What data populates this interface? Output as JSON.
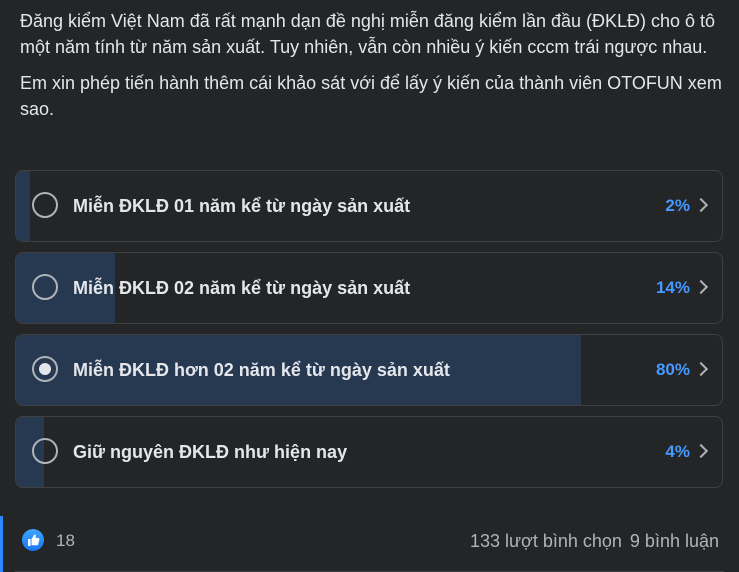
{
  "post": {
    "paragraphs": [
      "Đăng kiểm Việt Nam đã rất mạnh dạn đề nghị miễn đăng kiểm lần đầu (ĐKLĐ) cho ô tô một năm tính từ năm sản xuất. Tuy nhiên, vẫn còn nhiều ý kiến cccm trái ngược nhau.",
      "Em xin phép tiến hành thêm cái khảo sát với để lấy ý kiến của thành viên OTOFUN xem sao."
    ]
  },
  "poll": {
    "options": [
      {
        "label": "Miễn ĐKLĐ 01 năm kể từ ngày sản xuất",
        "percent_text": "2%",
        "percent": 2,
        "selected": false
      },
      {
        "label": "Miễn ĐKLĐ 02 năm kể từ ngày sản xuất",
        "percent_text": "14%",
        "percent": 14,
        "selected": false
      },
      {
        "label": "Miễn ĐKLĐ hơn 02 năm kể từ ngày sản xuất",
        "percent_text": "80%",
        "percent": 80,
        "selected": true
      },
      {
        "label": "Giữ nguyên ĐKLĐ như hiện nay",
        "percent_text": "4%",
        "percent": 4,
        "selected": false
      }
    ]
  },
  "footer": {
    "like_count": "18",
    "votes": "133 lượt bình chọn",
    "comments": "9 bình luận"
  },
  "colors": {
    "background": "#242526",
    "fill": "#263951",
    "percent": "#4599ff",
    "like": "#1877f2"
  },
  "icons": [
    "like-icon",
    "radio-icon",
    "chevron-right-icon"
  ]
}
